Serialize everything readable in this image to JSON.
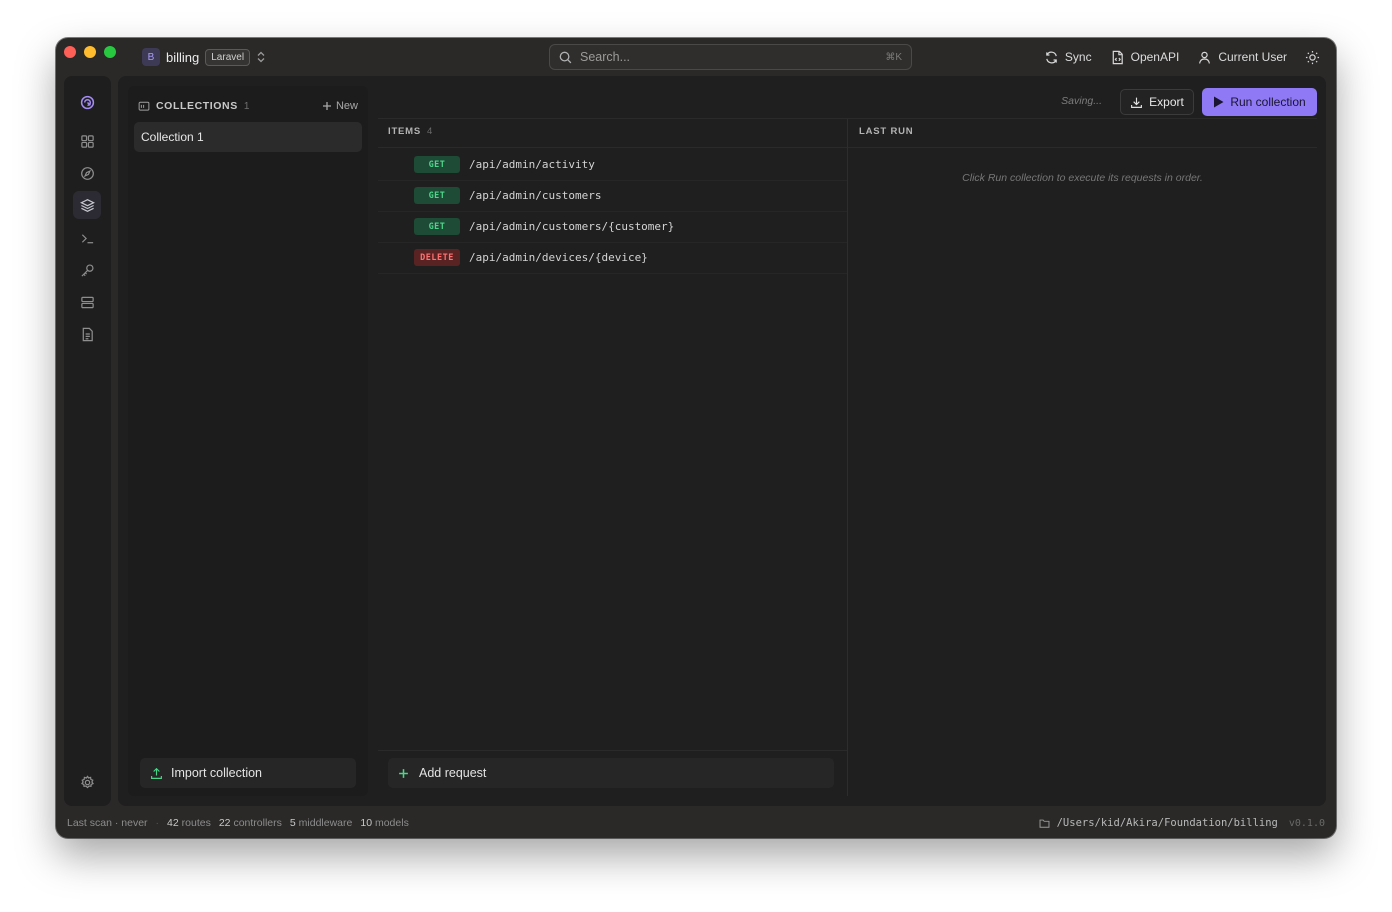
{
  "project": {
    "initial": "B",
    "name": "billing",
    "framework": "Laravel"
  },
  "search": {
    "placeholder": "Search...",
    "shortcut": "⌘K"
  },
  "top_actions": {
    "sync": "Sync",
    "openapi": "OpenAPI",
    "user": "Current User"
  },
  "rail": {
    "items": [
      "logo",
      "dashboard",
      "explore",
      "collections",
      "terminal",
      "keys",
      "database",
      "docs",
      "settings"
    ],
    "active": "collections"
  },
  "collections": {
    "title": "COLLECTIONS",
    "count": "1",
    "new_label": "New",
    "items": [
      "Collection 1"
    ],
    "import_label": "Import collection"
  },
  "toolbar": {
    "status": "Saving...",
    "export_label": "Export",
    "run_label": "Run collection"
  },
  "items_panel": {
    "label": "ITEMS",
    "count": "4",
    "requests": [
      {
        "method": "GET",
        "path": "/api/admin/activity"
      },
      {
        "method": "GET",
        "path": "/api/admin/customers"
      },
      {
        "method": "GET",
        "path": "/api/admin/customers/{customer}"
      },
      {
        "method": "DELETE",
        "path": "/api/admin/devices/{device}"
      }
    ],
    "add_label": "Add request"
  },
  "last_run": {
    "label": "LAST RUN",
    "message": "Click Run collection to execute its requests in order."
  },
  "status_bar": {
    "last_scan": "Last scan · never",
    "routes_count": "42",
    "routes_label": "routes",
    "controllers_count": "22",
    "controllers_label": "controllers",
    "middleware_count": "5",
    "middleware_label": "middleware",
    "models_count": "10",
    "models_label": "models",
    "path": "/Users/kid/Akira/Foundation/billing",
    "version": "v0.1.0"
  },
  "colors": {
    "accent": "#8f79f4",
    "get": "#4bd68a",
    "delete": "#ff7272"
  }
}
